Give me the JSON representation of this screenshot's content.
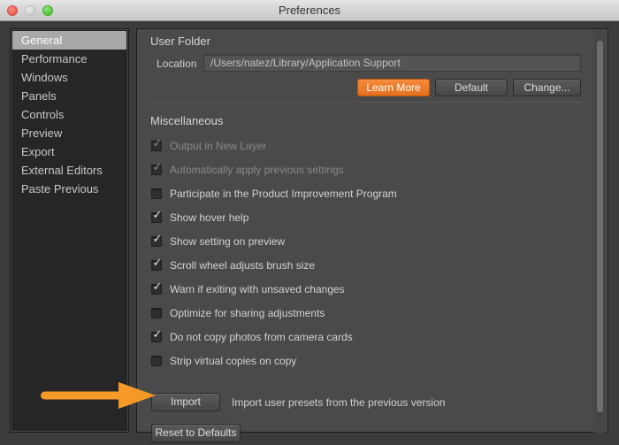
{
  "window": {
    "title": "Preferences",
    "traffic_lights": [
      "close-button",
      "minimize-button",
      "maximize-button"
    ]
  },
  "sidebar": {
    "items": [
      {
        "label": "General",
        "selected": true
      },
      {
        "label": "Performance",
        "selected": false
      },
      {
        "label": "Windows",
        "selected": false
      },
      {
        "label": "Panels",
        "selected": false
      },
      {
        "label": "Controls",
        "selected": false
      },
      {
        "label": "Preview",
        "selected": false
      },
      {
        "label": "Export",
        "selected": false
      },
      {
        "label": "External Editors",
        "selected": false
      },
      {
        "label": "Paste Previous",
        "selected": false
      }
    ]
  },
  "main": {
    "user_folder": {
      "section_title": "User Folder",
      "location_label": "Location",
      "location_value": "/Users/natez/Library/Application Support",
      "buttons": {
        "learn_more": "Learn More",
        "default": "Default",
        "change": "Change..."
      }
    },
    "miscellaneous": {
      "section_title": "Miscellaneous",
      "checkboxes": [
        {
          "label": "Output in New Layer",
          "checked": true,
          "disabled": true
        },
        {
          "label": "Automatically apply previous settings",
          "checked": true,
          "disabled": true
        },
        {
          "label": "Participate in the Product Improvement Program",
          "checked": false,
          "disabled": false
        },
        {
          "label": "Show hover help",
          "checked": true,
          "disabled": false
        },
        {
          "label": "Show setting on preview",
          "checked": true,
          "disabled": false
        },
        {
          "label": "Scroll wheel adjusts brush size",
          "checked": true,
          "disabled": false
        },
        {
          "label": "Warn if exiting with unsaved changes",
          "checked": true,
          "disabled": false
        },
        {
          "label": "Optimize for sharing adjustments",
          "checked": false,
          "disabled": false
        },
        {
          "label": "Do not copy photos from camera cards",
          "checked": true,
          "disabled": false
        },
        {
          "label": "Strip virtual copies on copy",
          "checked": false,
          "disabled": false
        }
      ],
      "import_button": "Import",
      "import_note": "Import user presets from the previous version",
      "reset_button": "Reset to Defaults"
    }
  },
  "annotation": {
    "arrow_color": "#f59a28",
    "arrow_points_to": "import-button"
  },
  "colors": {
    "accent_orange": "#e5701f",
    "panel_bg": "#4a4a4a",
    "sidebar_bg": "#262626",
    "selected_row": "#a8a8a8"
  }
}
